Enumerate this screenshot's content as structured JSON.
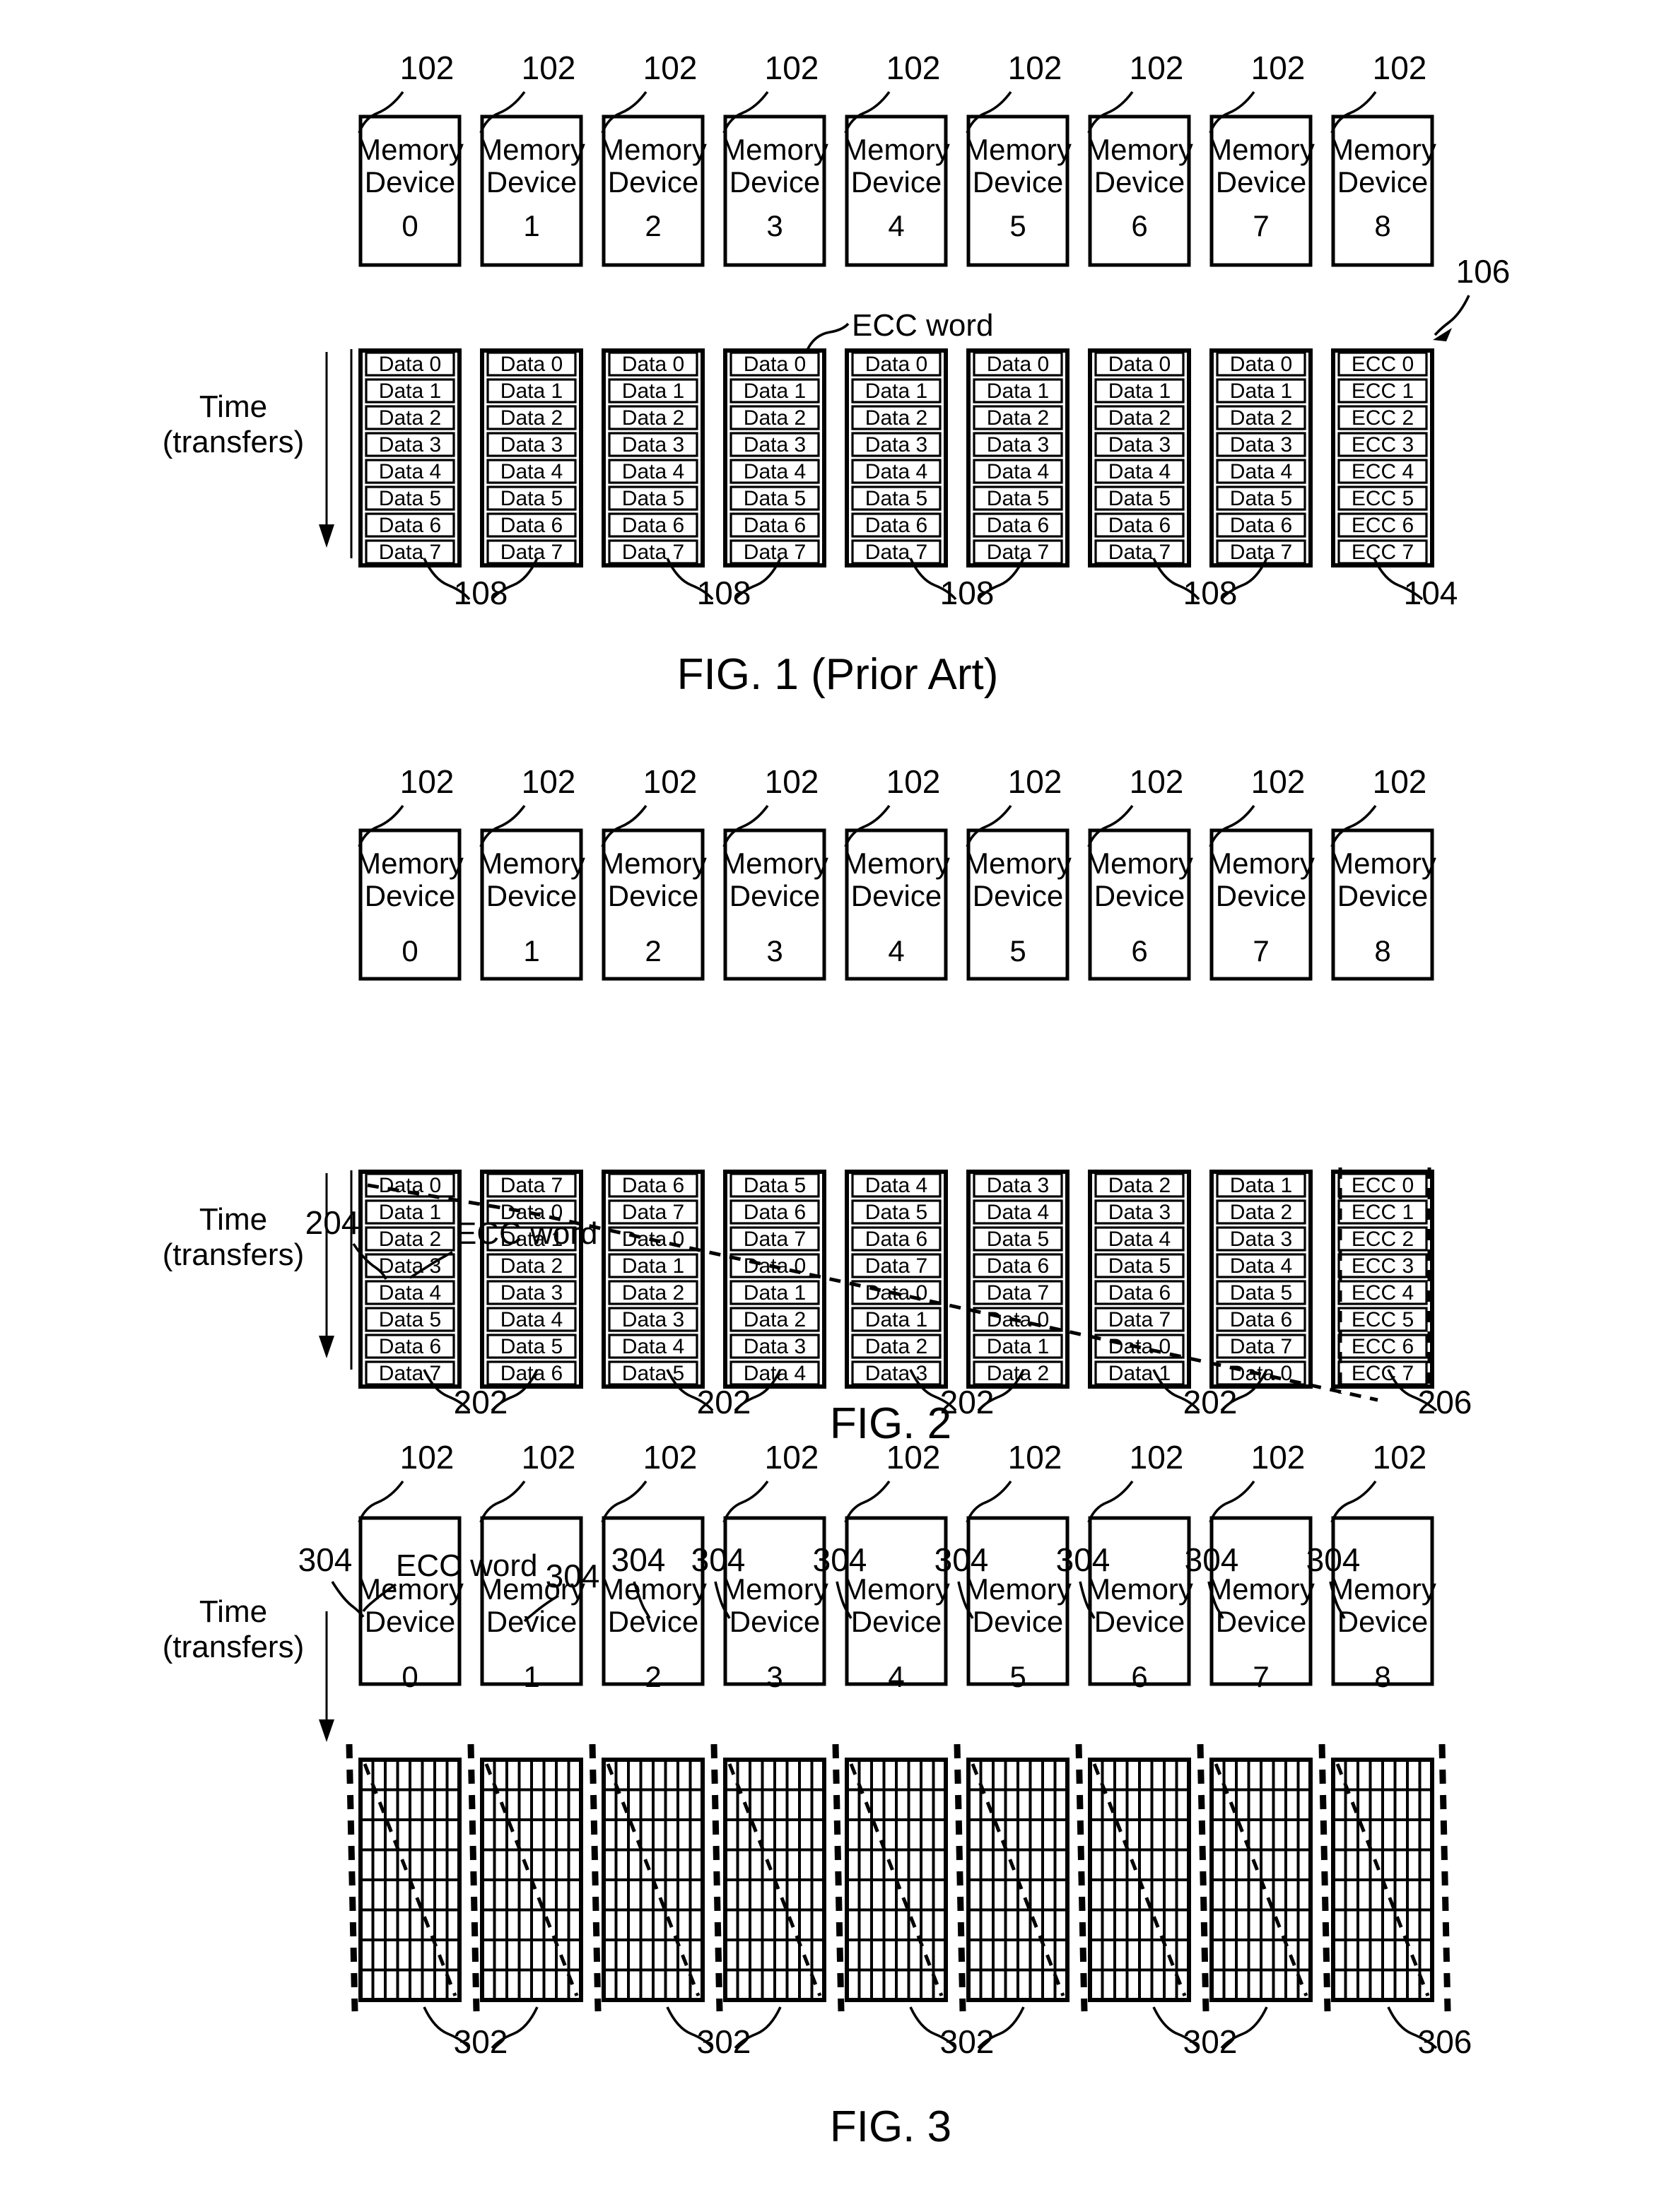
{
  "document": {
    "type": "patent-figure-sheet",
    "figures": [
      "FIG. 1 (Prior Art)",
      "FIG. 2",
      "FIG. 3"
    ]
  },
  "common": {
    "device_line1": "Memory",
    "device_line2": "Device",
    "device_numbers": [
      "0",
      "1",
      "2",
      "3",
      "4",
      "5",
      "6",
      "7",
      "8"
    ],
    "device_ref": "102",
    "time_label_line1": "Time",
    "time_label_line2": "(transfers)",
    "ecc_word_label": "ECC word"
  },
  "figure1": {
    "caption": "FIG. 1 (Prior Art)",
    "device_refs": [
      "102",
      "102",
      "102",
      "102",
      "102",
      "102",
      "102",
      "102",
      "102"
    ],
    "columns": [
      {
        "cells": [
          "Data 0",
          "Data 1",
          "Data 2",
          "Data 3",
          "Data 4",
          "Data 5",
          "Data 6",
          "Data 7"
        ]
      },
      {
        "cells": [
          "Data 0",
          "Data 1",
          "Data 2",
          "Data 3",
          "Data 4",
          "Data 5",
          "Data 6",
          "Data 7"
        ]
      },
      {
        "cells": [
          "Data 0",
          "Data 1",
          "Data 2",
          "Data 3",
          "Data 4",
          "Data 5",
          "Data 6",
          "Data 7"
        ]
      },
      {
        "cells": [
          "Data 0",
          "Data 1",
          "Data 2",
          "Data 3",
          "Data 4",
          "Data 5",
          "Data 6",
          "Data 7"
        ]
      },
      {
        "cells": [
          "Data 0",
          "Data 1",
          "Data 2",
          "Data 3",
          "Data 4",
          "Data 5",
          "Data 6",
          "Data 7"
        ]
      },
      {
        "cells": [
          "Data 0",
          "Data 1",
          "Data 2",
          "Data 3",
          "Data 4",
          "Data 5",
          "Data 6",
          "Data 7"
        ]
      },
      {
        "cells": [
          "Data 0",
          "Data 1",
          "Data 2",
          "Data 3",
          "Data 4",
          "Data 5",
          "Data 6",
          "Data 7"
        ]
      },
      {
        "cells": [
          "Data 0",
          "Data 1",
          "Data 2",
          "Data 3",
          "Data 4",
          "Data 5",
          "Data 6",
          "Data 7"
        ]
      },
      {
        "cells": [
          "ECC 0",
          "ECC 1",
          "ECC 2",
          "ECC 3",
          "ECC 4",
          "ECC 5",
          "ECC 6",
          "ECC 7"
        ]
      }
    ],
    "bottom_refs": [
      "108",
      "108",
      "108",
      "108"
    ],
    "ecc_col_ref_bottom": "104",
    "ecc_word_ref_top": "106",
    "ecc_word_label": "ECC word"
  },
  "figure2": {
    "caption": "FIG. 2",
    "device_refs": [
      "102",
      "102",
      "102",
      "102",
      "102",
      "102",
      "102",
      "102",
      "102"
    ],
    "ecc_word_ref": "204",
    "ecc_word_label": "ECC word",
    "columns": [
      {
        "cells": [
          "Data 0",
          "Data 1",
          "Data 2",
          "Data 3",
          "Data 4",
          "Data 5",
          "Data 6",
          "Data 7"
        ]
      },
      {
        "cells": [
          "Data 7",
          "Data 0",
          "Data 1",
          "Data 2",
          "Data 3",
          "Data 4",
          "Data 5",
          "Data 6"
        ]
      },
      {
        "cells": [
          "Data 6",
          "Data 7",
          "Data 0",
          "Data 1",
          "Data 2",
          "Data 3",
          "Data 4",
          "Data 5"
        ]
      },
      {
        "cells": [
          "Data 5",
          "Data 6",
          "Data 7",
          "Data 0",
          "Data 1",
          "Data 2",
          "Data 3",
          "Data 4"
        ]
      },
      {
        "cells": [
          "Data 4",
          "Data 5",
          "Data 6",
          "Data 7",
          "Data 0",
          "Data 1",
          "Data 2",
          "Data 3"
        ]
      },
      {
        "cells": [
          "Data 3",
          "Data 4",
          "Data 5",
          "Data 6",
          "Data 7",
          "Data 0",
          "Data 1",
          "Data 2"
        ]
      },
      {
        "cells": [
          "Data 2",
          "Data 3",
          "Data 4",
          "Data 5",
          "Data 6",
          "Data 7",
          "Data 0",
          "Data 1"
        ]
      },
      {
        "cells": [
          "Data 1",
          "Data 2",
          "Data 3",
          "Data 4",
          "Data 5",
          "Data 6",
          "Data 7",
          "Data 0"
        ]
      },
      {
        "cells": [
          "ECC 0",
          "ECC 1",
          "ECC 2",
          "ECC 3",
          "ECC 4",
          "ECC 5",
          "ECC 6",
          "ECC 7"
        ]
      }
    ],
    "bottom_refs": [
      "202",
      "202",
      "202",
      "202"
    ],
    "ecc_col_ref_bottom": "206"
  },
  "figure3": {
    "caption": "FIG. 3",
    "device_refs": [
      "102",
      "102",
      "102",
      "102",
      "102",
      "102",
      "102",
      "102",
      "102"
    ],
    "ecc_word_label": "ECC word",
    "top_refs": [
      "304",
      "304",
      "304",
      "304",
      "304",
      "304",
      "304",
      "304",
      "304"
    ],
    "grid": {
      "rows": 8,
      "subcolumns": 8,
      "columns": 9
    },
    "bottom_refs": [
      "302",
      "302",
      "302",
      "302"
    ],
    "ecc_col_ref_bottom": "306"
  }
}
